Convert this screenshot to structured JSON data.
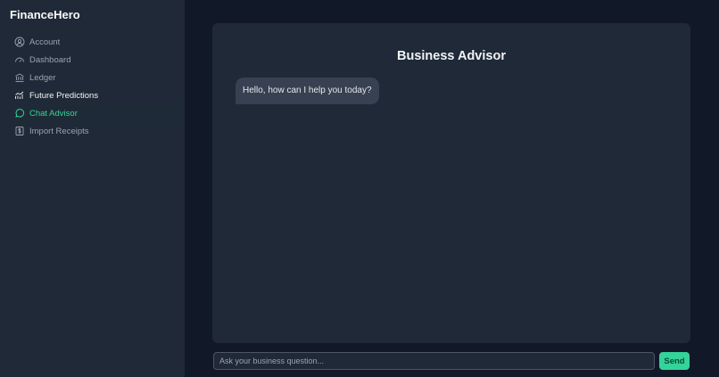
{
  "sidebar": {
    "brand": "FinanceHero",
    "items": [
      {
        "label": "Account",
        "icon": "user-circle-icon"
      },
      {
        "label": "Dashboard",
        "icon": "gauge-icon"
      },
      {
        "label": "Ledger",
        "icon": "bank-icon"
      },
      {
        "label": "Future Predictions",
        "icon": "chart-up-icon"
      },
      {
        "label": "Chat Advisor",
        "icon": "chat-bubble-icon",
        "active": true
      },
      {
        "label": "Import Receipts",
        "icon": "receipt-dollar-icon"
      }
    ]
  },
  "chat": {
    "title": "Business Advisor",
    "messages": [
      {
        "sender": "advisor",
        "text": "Hello, how can I help you today?"
      }
    ],
    "input_placeholder": "Ask your business question...",
    "input_value": "",
    "send_label": "Send"
  },
  "colors": {
    "accent": "#34d399",
    "sidebar_bg": "#1f2937",
    "page_bg": "#111827",
    "bubble_bg": "#374151"
  }
}
